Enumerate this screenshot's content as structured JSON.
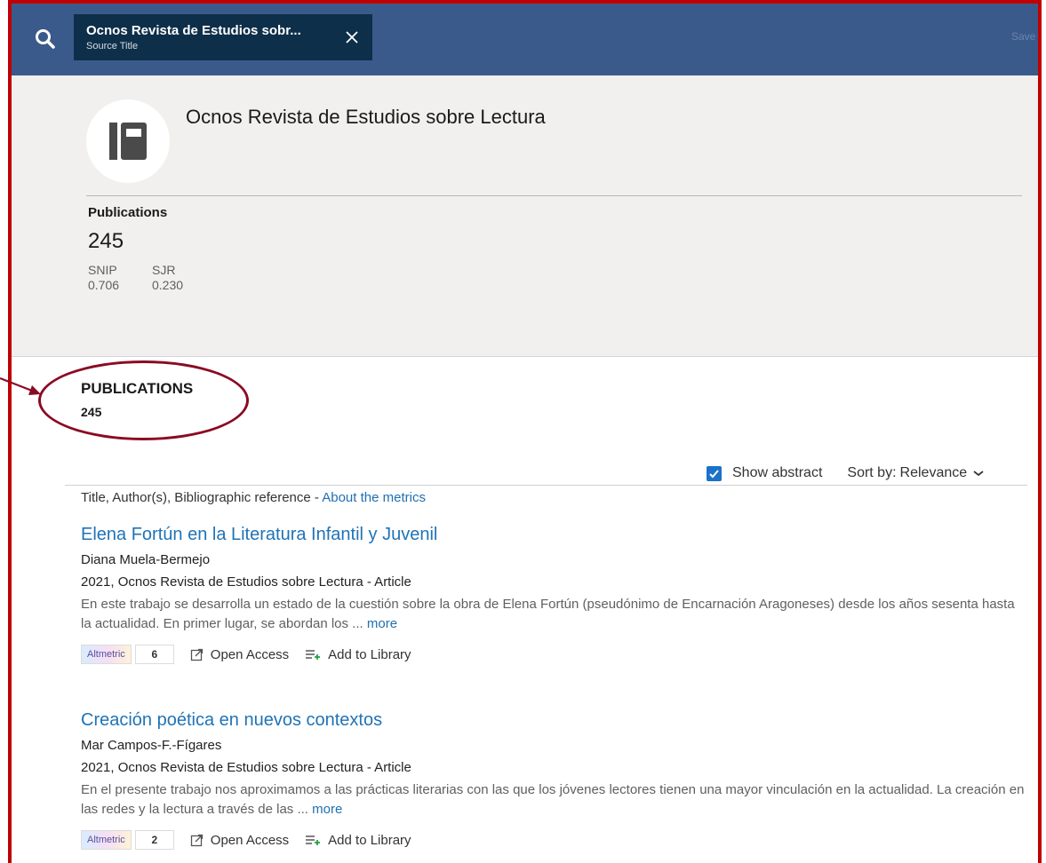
{
  "topbar": {
    "tab_title": "Ocnos Revista de Estudios sobr...",
    "tab_subtitle": "Source Title",
    "save_label": "Save /"
  },
  "source": {
    "name": "Ocnos Revista de Estudios sobre Lectura",
    "publications_label": "Publications",
    "publications_count": "245",
    "metrics": [
      {
        "label": "SNIP",
        "value": "0.706"
      },
      {
        "label": "SJR",
        "value": "0.230"
      }
    ]
  },
  "publications": {
    "heading": "PUBLICATIONS",
    "count": "245",
    "show_abstract_label": "Show abstract",
    "show_abstract_checked": true,
    "sort_label": "Sort by:",
    "sort_value": "Relevance",
    "columns_caption": "Title, Author(s), Bibliographic reference -",
    "about_metrics_link": "About the metrics",
    "items": [
      {
        "title": "Elena Fortún en la Literatura Infantil y Juvenil",
        "author": "Diana Muela-Bermejo",
        "reference": "2021, Ocnos Revista de Estudios sobre Lectura - Article",
        "abstract": "En este trabajo se desarrolla un estado de la cuestión sobre la obra de Elena Fortún (pseudónimo de Encarnación Aragoneses) desde los años sesenta hasta la actualidad. En primer lugar, se abordan los ...",
        "more_label": "more",
        "altmetric_label": "Altmetric",
        "altmetric_score": "6",
        "open_access_label": "Open Access",
        "add_library_label": "Add to Library"
      },
      {
        "title": "Creación poética en nuevos contextos",
        "author": "Mar Campos-F.-Fígares",
        "reference": "2021, Ocnos Revista de Estudios sobre Lectura - Article",
        "abstract": "En el presente trabajo nos aproximamos a las prácticas literarias con las que los jóvenes lectores tienen una mayor vinculación en la actualidad. La creación en las redes y la lectura a través de las ...",
        "more_label": "more",
        "altmetric_label": "Altmetric",
        "altmetric_score": "2",
        "open_access_label": "Open Access",
        "add_library_label": "Add to Library"
      }
    ]
  },
  "colors": {
    "topbar": "#3b5a8c",
    "tab": "#0e2f49",
    "header_bg": "#f1f0ee",
    "link": "#1f73b7",
    "frame": "#c00000",
    "annotation": "#8b0a23",
    "checkbox": "#1a73c9"
  },
  "icons": [
    "search-icon",
    "close-icon",
    "journal-icon",
    "checkbox-check-icon",
    "chevron-down-icon",
    "external-link-icon",
    "add-to-library-icon"
  ]
}
